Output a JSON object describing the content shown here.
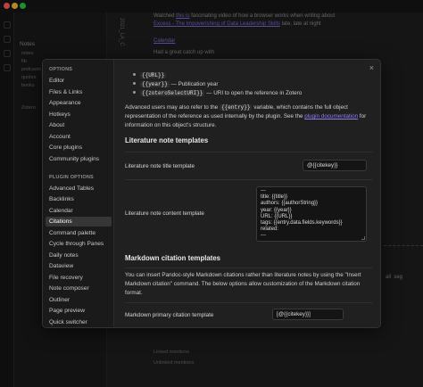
{
  "background": {
    "files_title": "Notes",
    "file_rows": [
      "notes",
      "fib",
      "podcasts",
      "quotes",
      "books",
      "Zotero"
    ],
    "vertical_title": "2021_LA_C",
    "lines": [
      {
        "text": "Watched ",
        "link": "this is",
        "rest": " fascinating video of how a browser works when writing about "
      },
      {
        "text": "",
        "link": "Excess - The Impoverishing of Data Leadership Skills",
        "rest": " late, late at night"
      },
      {
        "text": "",
        "link": "Calendar",
        "rest": ""
      },
      {
        "text": "Had a great catch up with ",
        "link": "",
        "rest": ""
      }
    ],
    "bottom_items": [
      "Linked mentions",
      "Unlinked mentions"
    ],
    "right_fragment": "all  seg"
  },
  "modal": {
    "close_label": "×",
    "sidebar": {
      "options_heading": "OPTIONS",
      "options_items": [
        "Editor",
        "Files & Links",
        "Appearance",
        "Hotkeys",
        "About",
        "Account",
        "Core plugins",
        "Community plugins"
      ],
      "plugin_heading": "PLUGIN OPTIONS",
      "plugin_items": [
        "Advanced Tables",
        "Backlinks",
        "Calendar",
        "Citations",
        "Command palette",
        "Cycle through Panes",
        "Daily notes",
        "Dataview",
        "File recovery",
        "Note composer",
        "Outliner",
        "Page preview",
        "Quick switcher"
      ],
      "active_item": "Citations"
    },
    "content": {
      "bullets": [
        {
          "code": "{{URL}}",
          "desc": ""
        },
        {
          "code": "{{year}}",
          "desc": " — Publication year"
        },
        {
          "code": "{{zoteroSelectURI}}",
          "desc": " — URI to open the reference in Zotero"
        }
      ],
      "entry_para_pre": "Advanced users may also refer to the ",
      "entry_para_code": "{{entry}}",
      "entry_para_post": " variable, which contains the full object representation of the reference as used internally by the plugin. See the ",
      "entry_para_link": "plugin documentation",
      "entry_para_end": " for information on this object's structure.",
      "lit_heading": "Literature note templates",
      "title_label": "Literature note title template",
      "title_value": "@{{citekey}}",
      "content_label": "Literature note content template",
      "content_lines": [
        "---",
        "title: {{title}}",
        "authors: {{authorString}}",
        "year: {{year}}",
        "URL: {{URL}}",
        "tags: {{entry.data.fields.keywords}}",
        "related:",
        "---"
      ],
      "md_heading": "Markdown citation templates",
      "md_para": "You can insert Pandoc-style Markdown citations rather than literature notes by using the \"Insert Markdown citation\" command. The below options allow customization of the Markdown citation format.",
      "primary_label": "Markdown primary citation template",
      "primary_value": "[@{{citekey}}]"
    }
  }
}
